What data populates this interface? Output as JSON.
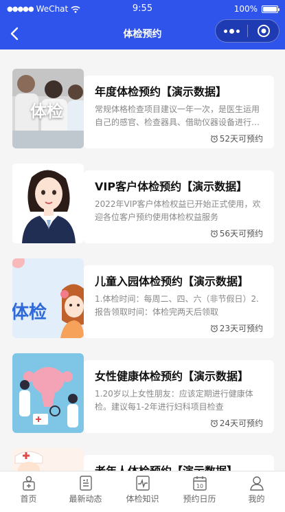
{
  "status_bar": {
    "carrier": "WeChat",
    "time": "9:55",
    "battery_text": "100%",
    "battery_level": 1.0
  },
  "nav": {
    "title": "体检预约",
    "back_icon": "chevron-left-icon",
    "more_icon": "more-dots-icon",
    "close_icon": "target-circle-icon"
  },
  "colors": {
    "header_bg": "#2f54eb",
    "capsule_bg": "#1e3bb3",
    "page_bg": "#f5f5f5"
  },
  "cards": [
    {
      "title": "年度体检预约【演示数据】",
      "desc": "常规体格检查项目建议一年一次，是医生运用自己的感官、检查器具、借助仪器设备进行检查",
      "days": "52天可预约",
      "thumb_text": "体检",
      "thumb_icon": "doctors-photo"
    },
    {
      "title": "VIP客户体检预约【演示数据】",
      "desc": "2022年VIP客户体检权益已开始正式使用，欢迎各位客户预约使用体检权益服务",
      "days": "56天可预约",
      "thumb_text": "",
      "thumb_icon": "woman-avatar-illustration"
    },
    {
      "title": "儿童入园体检预约【演示数据】",
      "desc": "1.体检时间：每周二、四、六（非节假日）2.报告领取时间：体检完两天后领取",
      "days": "23天可预约",
      "thumb_text": "体检",
      "thumb_icon": "child-illustration"
    },
    {
      "title": "女性健康体检预约【演示数据】",
      "desc": "1.20岁以上女性朋友：应该定期进行健康体检。建议每1-2年进行妇科项目检查",
      "days": "24天可预约",
      "thumb_text": "",
      "thumb_icon": "female-health-illustration"
    },
    {
      "title": "老年人体检预约【演示数据】",
      "desc": "",
      "days": "",
      "thumb_text": "",
      "thumb_icon": "nurse-illustration"
    }
  ],
  "tabbar": [
    {
      "label": "首页",
      "icon": "home-plus-icon"
    },
    {
      "label": "最新动态",
      "icon": "news-icon"
    },
    {
      "label": "体检知识",
      "icon": "heartbeat-icon"
    },
    {
      "label": "预约日历",
      "icon": "calendar-icon"
    },
    {
      "label": "我的",
      "icon": "user-icon"
    }
  ]
}
